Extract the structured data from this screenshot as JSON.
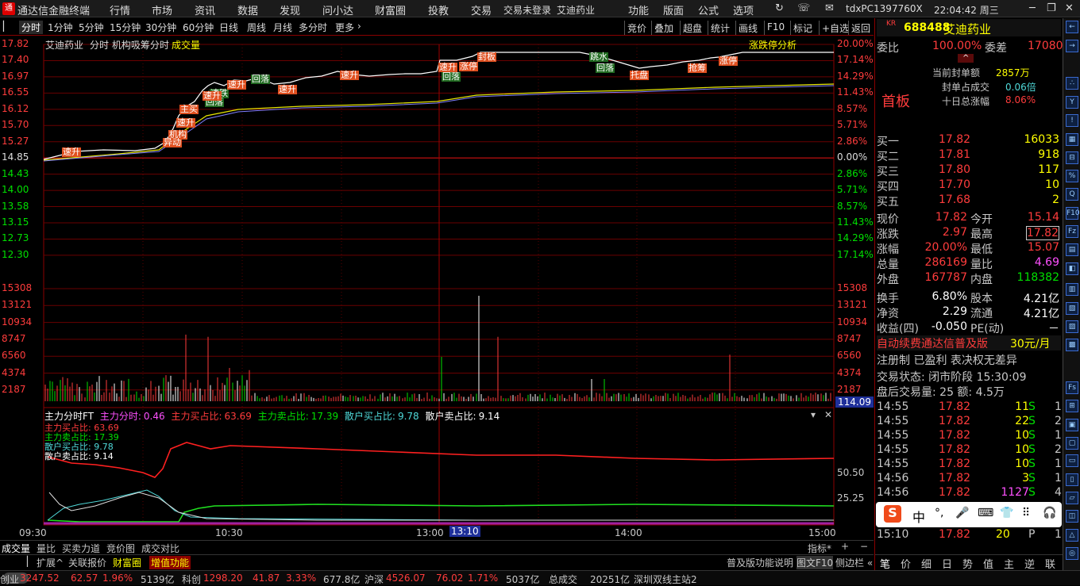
{
  "app": {
    "title": "通达信金融终端",
    "menu": [
      "行情",
      "市场",
      "资讯",
      "数据",
      "发现",
      "问小达",
      "财富圈",
      "投教",
      "交易"
    ],
    "trade_status": "交易未登录",
    "stock_tag": "艾迪药业",
    "right_menu": [
      "功能",
      "版面",
      "公式",
      "选项"
    ],
    "user": "tdxPC1397760X",
    "clock": "22:04:42 周三"
  },
  "periods": [
    "分时",
    "1分钟",
    "5分钟",
    "15分钟",
    "30分钟",
    "60分钟",
    "日线",
    "周线",
    "月线",
    "多分时",
    "更多"
  ],
  "tools": [
    "竞价",
    "叠加",
    "超盘",
    "统计",
    "画线",
    "F10",
    "标记",
    "+自选",
    "返回"
  ],
  "chart": {
    "stock": "艾迪药业",
    "mode": "分时 机构吸筹分时",
    "vol_label": "成交量",
    "analysis_link": "涨跌停分析",
    "price_ticks": [
      "17.82",
      "17.40",
      "16.97",
      "16.55",
      "16.12",
      "15.70",
      "15.27",
      "14.85",
      "14.43",
      "14.00",
      "13.58",
      "13.15",
      "12.73",
      "12.30"
    ],
    "pct_ticks": [
      "20.00%",
      "17.14%",
      "14.29%",
      "11.43%",
      "8.57%",
      "5.71%",
      "2.86%",
      "0.00%",
      "2.86%",
      "5.71%",
      "8.57%",
      "11.43%",
      "14.29%",
      "17.14%"
    ],
    "vol_ticks": [
      "15308",
      "13121",
      "10934",
      "8747",
      "6560",
      "4374",
      "2187"
    ],
    "vol_current": "114.09",
    "flags": [
      {
        "t": "速升",
        "c": "r"
      },
      {
        "t": "机构",
        "c": "r"
      },
      {
        "t": "异动",
        "c": "r"
      },
      {
        "t": "速升",
        "c": "r"
      },
      {
        "t": "主买",
        "c": "r"
      },
      {
        "t": "速跌",
        "c": "g"
      },
      {
        "t": "回落",
        "c": "g"
      },
      {
        "t": "速升",
        "c": "r"
      },
      {
        "t": "速升",
        "c": "r"
      },
      {
        "t": "回落",
        "c": "g"
      },
      {
        "t": "速升",
        "c": "r"
      },
      {
        "t": "速升",
        "c": "r"
      },
      {
        "t": "回落",
        "c": "g"
      },
      {
        "t": "速升",
        "c": "r"
      },
      {
        "t": "涨停",
        "c": "r"
      },
      {
        "t": "封板",
        "c": "r"
      },
      {
        "t": "跳水",
        "c": "g"
      },
      {
        "t": "回落",
        "c": "g"
      },
      {
        "t": "托盘",
        "c": "r"
      },
      {
        "t": "抢筹",
        "c": "r"
      },
      {
        "t": "涨停",
        "c": "r"
      }
    ],
    "indicator": {
      "name": "主力分时FT",
      "items": [
        {
          "l": "主力分时:",
          "v": "0.46"
        },
        {
          "l": "主力买占比:",
          "v": "63.69"
        },
        {
          "l": "主力卖占比:",
          "v": "17.39"
        },
        {
          "l": "散户买占比:",
          "v": "9.78"
        },
        {
          "l": "散户卖占比:",
          "v": "9.14"
        }
      ],
      "ticks": [
        "50.50",
        "25.25"
      ]
    },
    "time_ticks": [
      "09:30",
      "10:30",
      "13:00",
      "14:00",
      "15:00"
    ],
    "cursor_time": "13:10"
  },
  "bottom_tabs": [
    "成交量",
    "量比",
    "买卖力道",
    "竞价图",
    "成交对比"
  ],
  "bottom_tabs2": [
    "扩展^",
    "关联报价",
    "财富圈",
    "增值功能"
  ],
  "indicator_menu": "指标*",
  "right": {
    "code": "688488",
    "name": "艾迪药业",
    "market": "KR",
    "weibi_l": "委比",
    "weibi": "100.00%",
    "weicha_l": "委差",
    "weicha": "17080",
    "board": "首板",
    "seal_amt_l": "当前封单额",
    "seal_amt": "2857万",
    "seal_ratio_l": "封单占成交",
    "seal_ratio": "0.06倍",
    "ten_day_l": "十日总涨幅",
    "ten_day": "8.06%",
    "bids": [
      {
        "l": "买一",
        "p": "17.82",
        "v": "16033"
      },
      {
        "l": "买二",
        "p": "17.81",
        "v": "918"
      },
      {
        "l": "买三",
        "p": "17.80",
        "v": "117"
      },
      {
        "l": "买四",
        "p": "17.70",
        "v": "10"
      },
      {
        "l": "买五",
        "p": "17.68",
        "v": "2"
      }
    ],
    "quote": [
      {
        "a": "现价",
        "av": "17.82",
        "b": "今开",
        "bv": "15.14"
      },
      {
        "a": "涨跌",
        "av": "2.97",
        "b": "最高",
        "bv": "17.82"
      },
      {
        "a": "涨幅",
        "av": "20.00%",
        "b": "最低",
        "bv": "15.07"
      },
      {
        "a": "总量",
        "av": "286169",
        "b": "量比",
        "bv": "4.69"
      },
      {
        "a": "外盘",
        "av": "167787",
        "b": "内盘",
        "bv": "118382"
      }
    ],
    "fund": [
      {
        "a": "换手",
        "av": "6.80%",
        "b": "股本",
        "bv": "4.21亿"
      },
      {
        "a": "净资",
        "av": "2.29",
        "b": "流通",
        "bv": "4.21亿"
      },
      {
        "a": "收益(四)",
        "av": "-0.050",
        "b": "PE(动)",
        "bv": "－"
      }
    ],
    "ad1": "自动续费通达信普及版",
    "ad1b": "30元/月",
    "ad2": "注册制 已盈利 表决权无差异",
    "trade_state": "交易状态: 闭市阶段 15:30:09",
    "after": "盘后交易量: 25  额: 4.5万",
    "ticks": [
      {
        "t": "14:55",
        "p": "17.82",
        "v": "11",
        "d": "S",
        "n": "1"
      },
      {
        "t": "14:55",
        "p": "17.82",
        "v": "22",
        "d": "S",
        "n": "2"
      },
      {
        "t": "14:55",
        "p": "17.82",
        "v": "10",
        "d": "S",
        "n": "1"
      },
      {
        "t": "14:55",
        "p": "17.82",
        "v": "10",
        "d": "S",
        "n": "2"
      },
      {
        "t": "14:55",
        "p": "17.82",
        "v": "10",
        "d": "S",
        "n": "1"
      },
      {
        "t": "14:56",
        "p": "17.82",
        "v": "3",
        "d": "S",
        "n": "1"
      },
      {
        "t": "14:56",
        "p": "17.82",
        "v": "1127",
        "d": "S",
        "n": "4"
      }
    ],
    "last_tick": {
      "t": "15:10",
      "p": "17.82",
      "v": "20",
      "d": "P",
      "n": "1"
    },
    "ime": [
      "中",
      "°,",
      "🎤",
      "⌨",
      "👕",
      "⠿",
      "🎧"
    ],
    "bottom_tabs": [
      "笔",
      "价",
      "细",
      "日",
      "势",
      "值",
      "主",
      "逆",
      "联"
    ]
  },
  "status": {
    "items": [
      {
        "n": "创业",
        "v": "3247.52",
        "c": "62.57",
        "p": "1.96%",
        "a": "5139亿"
      },
      {
        "n": "科创",
        "v": "1298.20",
        "c": "41.87",
        "p": "3.33%",
        "a": "677.8亿"
      },
      {
        "n": "沪深",
        "v": "4526.07",
        "c": "76.02",
        "p": "1.71%",
        "a": "5037亿"
      }
    ],
    "total_l": "总成交",
    "total": "20251亿",
    "line": "深圳双线主站2",
    "pujiban": "普及版功能说明",
    "tuwen": "图文F10",
    "sidebar": "侧边栏 «"
  }
}
